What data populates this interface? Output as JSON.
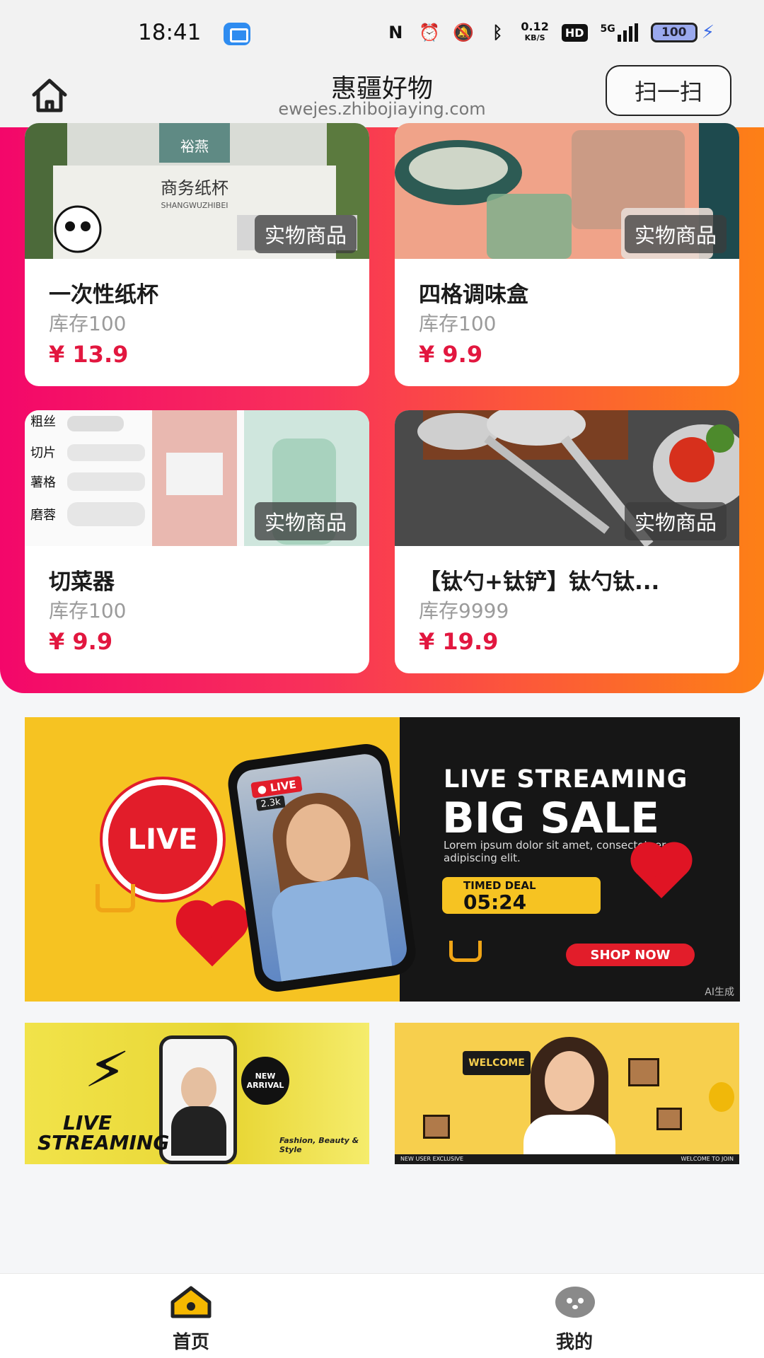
{
  "status_bar": {
    "time": "18:41",
    "net_speed_value": "0.12",
    "net_speed_unit": "KB/S",
    "hd_label": "HD",
    "network": "5G",
    "battery": "100"
  },
  "header": {
    "title": "惠疆好物",
    "subtitle": "ewejes.zhibojiaying.com",
    "scan_label": "扫一扫"
  },
  "products": [
    {
      "name": "一次性纸杯",
      "stock": "库存100",
      "price": "¥ 13.9",
      "tag": "实物商品"
    },
    {
      "name": "四格调味盒",
      "stock": "库存100",
      "price": "¥ 9.9",
      "tag": "实物商品"
    },
    {
      "name": "切菜器",
      "stock": "库存100",
      "price": "¥ 9.9",
      "tag": "实物商品"
    },
    {
      "name": "【钛勺+钛铲】钛勺钛...",
      "stock": "库存9999",
      "price": "¥ 19.9",
      "tag": "实物商品"
    }
  ],
  "product_image_text": {
    "cup_brand": "裕燕",
    "cup_title": "商务纸杯",
    "cup_pinyin": "SHANGWUZHIBEI",
    "cutter_labels": [
      "粗丝",
      "切片",
      "薯格",
      "磨蓉"
    ]
  },
  "main_banner": {
    "live_badge": "LIVE",
    "phone_live": "● LIVE",
    "phone_viewers": "2.3k",
    "headline_1": "LIVE STREAMING",
    "headline_2": "BIG SALE",
    "body": "Lorem ipsum dolor sit amet, consectetuer adipiscing elit.",
    "deal_label": "TIMED DEAL",
    "deal_time": "05:24",
    "cta": "SHOP NOW",
    "watermark": "AI生成"
  },
  "sub_banner_left": {
    "title_line1": "LIVE",
    "title_line2": "STREAMING",
    "badge": "NEW ARRIVAL",
    "caption": "Fashion, Beauty & Style"
  },
  "sub_banner_right": {
    "welcome": "WELCOME",
    "footer_left": "NEW USER EXCLUSIVE",
    "footer_right": "WELCOME TO JOIN"
  },
  "tabbar": {
    "home_label": "首页",
    "me_label": "我的"
  }
}
